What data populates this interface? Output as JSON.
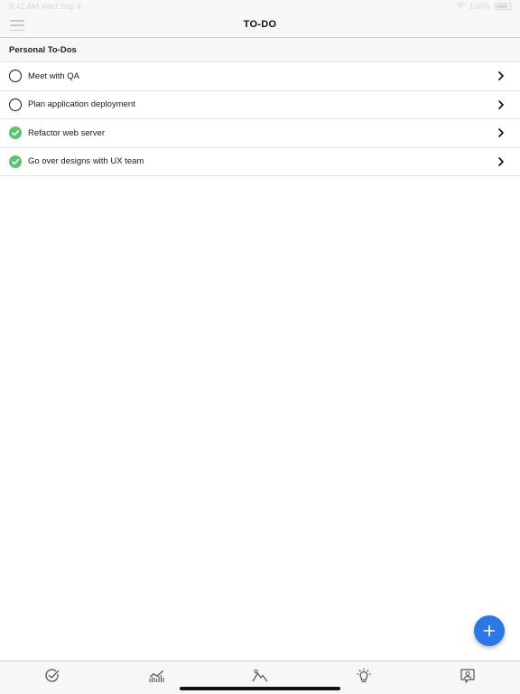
{
  "status_bar": {
    "time": "9:41 AM",
    "date": "Wed Sep 4",
    "battery": "100%"
  },
  "nav": {
    "title": "TO-DO",
    "menu_icon": "hamburger-menu-icon"
  },
  "section": {
    "title": "Personal To-Dos"
  },
  "todos": [
    {
      "label": "Meet with QA",
      "completed": false
    },
    {
      "label": "Plan application deployment",
      "completed": false
    },
    {
      "label": "Refactor web server",
      "completed": true
    },
    {
      "label": "Go over designs with UX team",
      "completed": true
    }
  ],
  "fab": {
    "label": "+",
    "icon": "plus-icon"
  },
  "tabs": [
    {
      "icon": "check-circle-icon"
    },
    {
      "icon": "bar-chart-icon"
    },
    {
      "icon": "mountain-icon"
    },
    {
      "icon": "lightbulb-icon"
    },
    {
      "icon": "profile-icon"
    }
  ],
  "colors": {
    "accent": "#2b78e4",
    "done": "#5ac36f",
    "bar_bg": "#f7f7f7"
  }
}
